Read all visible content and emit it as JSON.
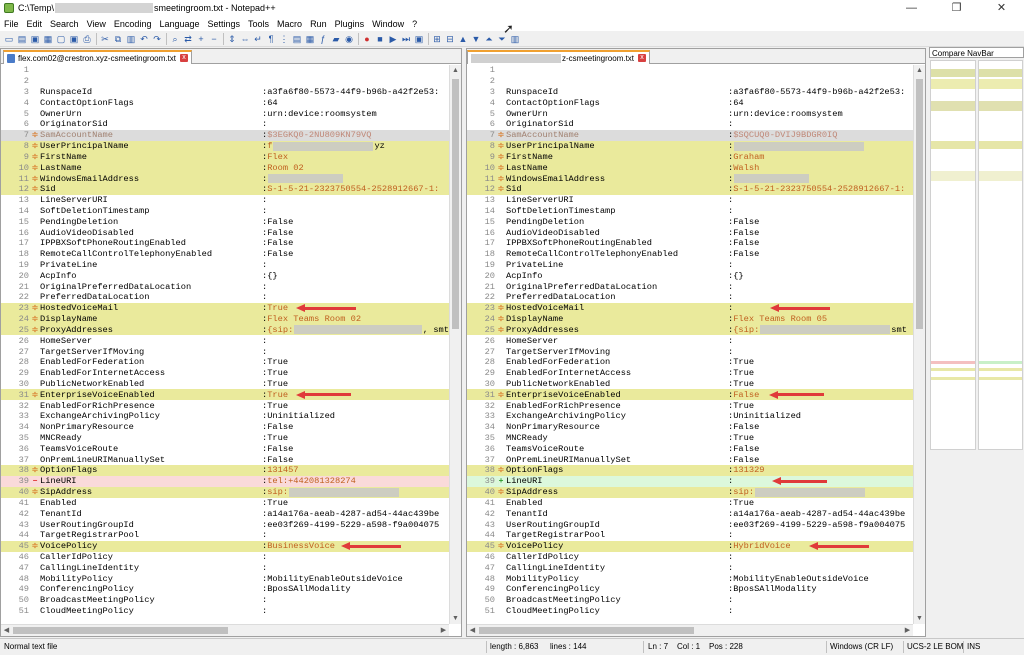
{
  "window": {
    "title_prefix": "C:\\Temp\\",
    "title_suffix": "smeetingroom.txt - Notepad++",
    "min": "—",
    "max": "❐",
    "close": "✕"
  },
  "menu": [
    "File",
    "Edit",
    "Search",
    "View",
    "Encoding",
    "Language",
    "Settings",
    "Tools",
    "Macro",
    "Run",
    "Plugins",
    "Window",
    "?"
  ],
  "toolbar_icons": [
    "new-file",
    "open-file",
    "save",
    "save-all",
    "close",
    "close-all",
    "print",
    "cut",
    "copy",
    "paste",
    "undo",
    "redo",
    "find",
    "replace",
    "zoom-in",
    "zoom-out",
    "sync-vertical",
    "sync-horizontal",
    "word-wrap",
    "show-all-chars",
    "indent-guide",
    "udl",
    "doc-map",
    "function-list",
    "folder-workspace",
    "monitor",
    "record-macro",
    "stop-record",
    "play-macro",
    "run-macro-multiple",
    "save-macro",
    "compare",
    "clear-compare",
    "prev-diff",
    "next-diff",
    "first-diff",
    "last-diff",
    "nav-bar"
  ],
  "left_tab": {
    "prefix": "",
    "name": "flex.com02@crestron.xyz-csmeetingroom.txt",
    "close": "x"
  },
  "right_tab": {
    "prefix": "",
    "name": "z-csmeetingroom.txt",
    "close": "x"
  },
  "navbar": {
    "title": "Compare NavBar"
  },
  "status": {
    "type": "Normal text file",
    "length": "length : 6,863",
    "lines": "lines : 144",
    "ln": "Ln : 7",
    "col": "Col : 1",
    "pos": "Pos : 228",
    "eol": "Windows (CR LF)",
    "enc": "UCS-2 LE BOM",
    "ins": "INS"
  },
  "left_lines": [
    {
      "n": "1",
      "k": "",
      "v": "",
      "c": ""
    },
    {
      "n": "2",
      "k": "",
      "v": "",
      "c": ""
    },
    {
      "n": "3",
      "k": "RunspaceId",
      "v": "a3fa6f80-5573-44f9-b96b-a42f2e53:",
      "c": ""
    },
    {
      "n": "4",
      "k": "ContactOptionFlags",
      "v": "64",
      "c": ""
    },
    {
      "n": "5",
      "k": "OwnerUrn",
      "v": "urn:device:roomsystem",
      "c": ""
    },
    {
      "n": "6",
      "k": "OriginatorSid",
      "v": "",
      "c": ""
    },
    {
      "n": "7",
      "k": "SamAccountName",
      "v": "$3EGKQ0-2NU809KN79VQ",
      "c": "cur"
    },
    {
      "n": "8",
      "k": "UserPrincipalName",
      "v": "f",
      "c": "hl",
      "r": "yz"
    },
    {
      "n": "9",
      "k": "FirstName",
      "v": "Flex",
      "c": "hl"
    },
    {
      "n": "10",
      "k": "LastName",
      "v": "Room 02",
      "c": "hl"
    },
    {
      "n": "11",
      "k": "WindowsEmailAddress",
      "v": "",
      "c": "hl",
      "r": ""
    },
    {
      "n": "12",
      "k": "Sid",
      "v": "S-1-5-21-2323750554-2528912667-1:",
      "c": "hl"
    },
    {
      "n": "13",
      "k": "LineServerURI",
      "v": "",
      "c": ""
    },
    {
      "n": "14",
      "k": "SoftDeletionTimestamp",
      "v": "",
      "c": ""
    },
    {
      "n": "15",
      "k": "PendingDeletion",
      "v": "False",
      "c": ""
    },
    {
      "n": "16",
      "k": "AudioVideoDisabled",
      "v": "False",
      "c": ""
    },
    {
      "n": "17",
      "k": "IPPBXSoftPhoneRoutingEnabled",
      "v": "False",
      "c": ""
    },
    {
      "n": "18",
      "k": "RemoteCallControlTelephonyEnabled",
      "v": "False",
      "c": ""
    },
    {
      "n": "19",
      "k": "PrivateLine",
      "v": "",
      "c": ""
    },
    {
      "n": "20",
      "k": "AcpInfo",
      "v": "{}",
      "c": ""
    },
    {
      "n": "21",
      "k": "OriginalPreferredDataLocation",
      "v": "",
      "c": ""
    },
    {
      "n": "22",
      "k": "PreferredDataLocation",
      "v": "",
      "c": ""
    },
    {
      "n": "23",
      "k": "HostedVoiceMail",
      "v": "True",
      "c": "hl",
      "a": 1
    },
    {
      "n": "24",
      "k": "DisplayName",
      "v": "Flex Teams Room 02",
      "c": "hl"
    },
    {
      "n": "25",
      "k": "ProxyAddresses",
      "v": "{sip:",
      "c": "hl",
      "r": ", smt"
    },
    {
      "n": "26",
      "k": "HomeServer",
      "v": "",
      "c": ""
    },
    {
      "n": "27",
      "k": "TargetServerIfMoving",
      "v": "",
      "c": ""
    },
    {
      "n": "28",
      "k": "EnabledForFederation",
      "v": "True",
      "c": ""
    },
    {
      "n": "29",
      "k": "EnabledForInternetAccess",
      "v": "True",
      "c": ""
    },
    {
      "n": "30",
      "k": "PublicNetworkEnabled",
      "v": "True",
      "c": ""
    },
    {
      "n": "31",
      "k": "EnterpriseVoiceEnabled",
      "v": "True",
      "c": "hl",
      "a": 1
    },
    {
      "n": "32",
      "k": "EnabledForRichPresence",
      "v": "True",
      "c": ""
    },
    {
      "n": "33",
      "k": "ExchangeArchivingPolicy",
      "v": "Uninitialized",
      "c": ""
    },
    {
      "n": "34",
      "k": "NonPrimaryResource",
      "v": "False",
      "c": ""
    },
    {
      "n": "35",
      "k": "MNCReady",
      "v": "True",
      "c": ""
    },
    {
      "n": "36",
      "k": "TeamsVoiceRoute",
      "v": "False",
      "c": ""
    },
    {
      "n": "37",
      "k": "OnPremLineURIManuallySet",
      "v": "False",
      "c": ""
    },
    {
      "n": "38",
      "k": "OptionFlags",
      "v": "131457",
      "c": "hl"
    },
    {
      "n": "39",
      "k": "LineURI",
      "v": "tel:+442081328274",
      "c": "del"
    },
    {
      "n": "40",
      "k": "SipAddress",
      "v": "sip:",
      "c": "hl",
      "r": ""
    },
    {
      "n": "41",
      "k": "Enabled",
      "v": "True",
      "c": ""
    },
    {
      "n": "42",
      "k": "TenantId",
      "v": "a14a176a-aeab-4287-ad54-44ac439be",
      "c": ""
    },
    {
      "n": "43",
      "k": "UserRoutingGroupId",
      "v": "ee03f269-4199-5229-a598-f9a004075",
      "c": ""
    },
    {
      "n": "44",
      "k": "TargetRegistrarPool",
      "v": "",
      "c": ""
    },
    {
      "n": "45",
      "k": "VoicePolicy",
      "v": "BusinessVoice",
      "c": "hl",
      "a": 1
    },
    {
      "n": "46",
      "k": "CallerIdPolicy",
      "v": "",
      "c": ""
    },
    {
      "n": "47",
      "k": "CallingLineIdentity",
      "v": "",
      "c": ""
    },
    {
      "n": "48",
      "k": "MobilityPolicy",
      "v": "MobilityEnableOutsideVoice",
      "c": ""
    },
    {
      "n": "49",
      "k": "ConferencingPolicy",
      "v": "BposSAllModality",
      "c": ""
    },
    {
      "n": "50",
      "k": "BroadcastMeetingPolicy",
      "v": "",
      "c": ""
    },
    {
      "n": "51",
      "k": "CloudMeetingPolicy",
      "v": "",
      "c": ""
    }
  ],
  "right_lines": [
    {
      "n": "1",
      "k": "",
      "v": "",
      "c": ""
    },
    {
      "n": "2",
      "k": "",
      "v": "",
      "c": ""
    },
    {
      "n": "3",
      "k": "RunspaceId",
      "v": "a3fa6f80-5573-44f9-b96b-a42f2e53:",
      "c": ""
    },
    {
      "n": "4",
      "k": "ContactOptionFlags",
      "v": "64",
      "c": ""
    },
    {
      "n": "5",
      "k": "OwnerUrn",
      "v": "urn:device:roomsystem",
      "c": ""
    },
    {
      "n": "6",
      "k": "OriginatorSid",
      "v": "",
      "c": ""
    },
    {
      "n": "7",
      "k": "SamAccountName",
      "v": "$SQCUQ0-DVIJ9BDGR0IQ",
      "c": "cur"
    },
    {
      "n": "8",
      "k": "UserPrincipalName",
      "v": "",
      "c": "hl",
      "r": ""
    },
    {
      "n": "9",
      "k": "FirstName",
      "v": "Graham",
      "c": "hl"
    },
    {
      "n": "10",
      "k": "LastName",
      "v": "Walsh",
      "c": "hl"
    },
    {
      "n": "11",
      "k": "WindowsEmailAddress",
      "v": "",
      "c": "hl",
      "r": ""
    },
    {
      "n": "12",
      "k": "Sid",
      "v": "S-1-5-21-2323750554-2528912667-1:",
      "c": "hl"
    },
    {
      "n": "13",
      "k": "LineServerURI",
      "v": "",
      "c": ""
    },
    {
      "n": "14",
      "k": "SoftDeletionTimestamp",
      "v": "",
      "c": ""
    },
    {
      "n": "15",
      "k": "PendingDeletion",
      "v": "False",
      "c": ""
    },
    {
      "n": "16",
      "k": "AudioVideoDisabled",
      "v": "False",
      "c": ""
    },
    {
      "n": "17",
      "k": "IPPBXSoftPhoneRoutingEnabled",
      "v": "False",
      "c": ""
    },
    {
      "n": "18",
      "k": "RemoteCallControlTelephonyEnabled",
      "v": "False",
      "c": ""
    },
    {
      "n": "19",
      "k": "PrivateLine",
      "v": "",
      "c": ""
    },
    {
      "n": "20",
      "k": "AcpInfo",
      "v": "{}",
      "c": ""
    },
    {
      "n": "21",
      "k": "OriginalPreferredDataLocation",
      "v": "",
      "c": ""
    },
    {
      "n": "22",
      "k": "PreferredDataLocation",
      "v": "",
      "c": ""
    },
    {
      "n": "23",
      "k": "HostedVoiceMail",
      "v": "",
      "c": "hl",
      "a": 1
    },
    {
      "n": "24",
      "k": "DisplayName",
      "v": "Flex Teams Room 05",
      "c": "hl"
    },
    {
      "n": "25",
      "k": "ProxyAddresses",
      "v": "{sip:",
      "c": "hl",
      "r": "smt"
    },
    {
      "n": "26",
      "k": "HomeServer",
      "v": "",
      "c": ""
    },
    {
      "n": "27",
      "k": "TargetServerIfMoving",
      "v": "",
      "c": ""
    },
    {
      "n": "28",
      "k": "EnabledForFederation",
      "v": "True",
      "c": ""
    },
    {
      "n": "29",
      "k": "EnabledForInternetAccess",
      "v": "True",
      "c": ""
    },
    {
      "n": "30",
      "k": "PublicNetworkEnabled",
      "v": "True",
      "c": ""
    },
    {
      "n": "31",
      "k": "EnterpriseVoiceEnabled",
      "v": "False",
      "c": "hl",
      "a": 1
    },
    {
      "n": "32",
      "k": "EnabledForRichPresence",
      "v": "True",
      "c": ""
    },
    {
      "n": "33",
      "k": "ExchangeArchivingPolicy",
      "v": "Uninitialized",
      "c": ""
    },
    {
      "n": "34",
      "k": "NonPrimaryResource",
      "v": "False",
      "c": ""
    },
    {
      "n": "35",
      "k": "MNCReady",
      "v": "True",
      "c": ""
    },
    {
      "n": "36",
      "k": "TeamsVoiceRoute",
      "v": "False",
      "c": ""
    },
    {
      "n": "37",
      "k": "OnPremLineURIManuallySet",
      "v": "False",
      "c": ""
    },
    {
      "n": "38",
      "k": "OptionFlags",
      "v": "131329",
      "c": "hl"
    },
    {
      "n": "39",
      "k": "LineURI",
      "v": "",
      "c": "add",
      "a": 1
    },
    {
      "n": "40",
      "k": "SipAddress",
      "v": "sip:",
      "c": "hl",
      "r": ""
    },
    {
      "n": "41",
      "k": "Enabled",
      "v": "True",
      "c": ""
    },
    {
      "n": "42",
      "k": "TenantId",
      "v": "a14a176a-aeab-4287-ad54-44ac439be",
      "c": ""
    },
    {
      "n": "43",
      "k": "UserRoutingGroupId",
      "v": "ee03f269-4199-5229-a598-f9a004075",
      "c": ""
    },
    {
      "n": "44",
      "k": "TargetRegistrarPool",
      "v": "",
      "c": ""
    },
    {
      "n": "45",
      "k": "VoicePolicy",
      "v": "HybridVoice",
      "c": "hl",
      "a": 1
    },
    {
      "n": "46",
      "k": "CallerIdPolicy",
      "v": "",
      "c": ""
    },
    {
      "n": "47",
      "k": "CallingLineIdentity",
      "v": "",
      "c": ""
    },
    {
      "n": "48",
      "k": "MobilityPolicy",
      "v": "MobilityEnableOutsideVoice",
      "c": ""
    },
    {
      "n": "49",
      "k": "ConferencingPolicy",
      "v": "BposSAllModality",
      "c": ""
    },
    {
      "n": "50",
      "k": "BroadcastMeetingPolicy",
      "v": "",
      "c": ""
    },
    {
      "n": "51",
      "k": "CloudMeetingPolicy",
      "v": "",
      "c": ""
    }
  ]
}
